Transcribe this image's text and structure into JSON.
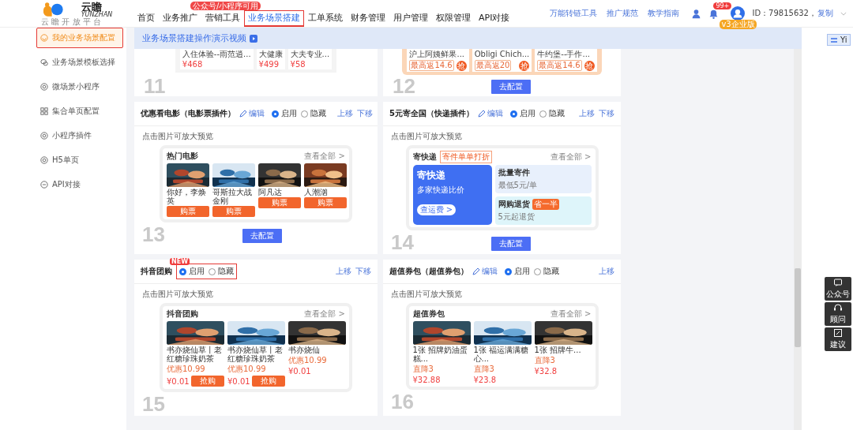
{
  "nav": {
    "logo": {
      "name": "云瞻",
      "latin": "YUNZHAN",
      "tagline": "云 瞻 开 放 平 台"
    },
    "menu": [
      {
        "label": "首页",
        "selected": false,
        "outlined": false
      },
      {
        "label": "业务推广",
        "selected": false,
        "outlined": false
      },
      {
        "label": "营销工具",
        "selected": false,
        "outlined": false,
        "badge": "公众号/小程序可用"
      },
      {
        "label": "业务场景搭建",
        "selected": true,
        "outlined": true
      },
      {
        "label": "工单系统",
        "selected": false,
        "outlined": false
      },
      {
        "label": "财务管理",
        "selected": false,
        "outlined": false
      },
      {
        "label": "用户管理",
        "selected": false,
        "outlined": false
      },
      {
        "label": "权限管理",
        "selected": false,
        "outlined": false
      },
      {
        "label": "API对接",
        "selected": false,
        "outlined": false
      }
    ],
    "links": [
      "万能转链工具",
      "推广规范",
      "教学指南"
    ],
    "notifications": "99+",
    "user": {
      "id": "ID：79815632，",
      "copy": "复制",
      "plan": "v3企业版"
    }
  },
  "sidebar": [
    {
      "label": "我的业务场景配置",
      "selected": true,
      "outlined": true
    },
    {
      "label": "业务场景模板选择",
      "selected": false,
      "outlined": false
    },
    {
      "label": "微场景小程序",
      "selected": false,
      "outlined": false
    },
    {
      "label": "集合单页配置",
      "selected": false,
      "outlined": false
    },
    {
      "label": "小程序插件",
      "selected": false,
      "outlined": false
    },
    {
      "label": "H5单页",
      "selected": false,
      "outlined": false
    },
    {
      "label": "API对接",
      "selected": false,
      "outlined": false
    }
  ],
  "banner": "业务场景搭建操作演示视频",
  "scrolled_cards": [
    {
      "number": "11",
      "preview": {
        "kind": "products",
        "items": [
          {
            "caption": "入住体验--雨范逍...",
            "price": "¥468"
          },
          {
            "caption": "大健康",
            "price": "¥499"
          },
          {
            "caption": "大夫专业...",
            "price": "¥58"
          }
        ]
      }
    },
    {
      "number": "12",
      "configure": "去配置",
      "preview": {
        "kind": "shops",
        "items": [
          {
            "caption": "沪上阿姨鲜果...",
            "tag": "最高返14.6",
            "action": "抢"
          },
          {
            "caption": "Obligi Chich...",
            "tag": "最高返20",
            "action": "抢"
          },
          {
            "caption": "牛约堡--手作...",
            "tag": "最高返14.6",
            "action": "抢"
          }
        ]
      }
    }
  ],
  "cards": [
    {
      "number": "13",
      "title": "优惠看电影（电影票插件）",
      "edit": "编辑",
      "outlined": false,
      "options": [
        {
          "label": "启用",
          "selected": true
        },
        {
          "label": "隐藏",
          "selected": false
        }
      ],
      "moves": [
        "上移",
        "下移"
      ],
      "hint": "点击图片可放大预览",
      "configure": "去配置",
      "preview": {
        "kind": "tiles",
        "title": "热门电影",
        "more": "查看全部 >",
        "items": [
          {
            "caption": "你好，李焕英",
            "action": "购票"
          },
          {
            "caption": "哥斯拉大战金刚",
            "action": "购票"
          },
          {
            "caption": "阿凡达",
            "action": "购票"
          },
          {
            "caption": "人潮汹",
            "action": "购票"
          }
        ]
      }
    },
    {
      "number": "14",
      "title": "5元寄全国（快递插件）",
      "edit": "编辑",
      "outlined": false,
      "options": [
        {
          "label": "启用",
          "selected": true
        },
        {
          "label": "隐藏",
          "selected": false
        }
      ],
      "moves": [
        "上移",
        "下移"
      ],
      "hint": "点击图片可放大预览",
      "configure": "去配置",
      "preview": {
        "kind": "express",
        "title": "寄快递",
        "tag": "寄件单单打折",
        "more": "查看全部 >",
        "main": {
          "title": "寄快递",
          "sub": "多家快递比价",
          "action": "查运费 >"
        },
        "tiles": [
          {
            "title": "批量寄件",
            "sub": "最低5元/单"
          },
          {
            "title": "网购退货",
            "sub": "5元起退货",
            "tag": "省一半"
          }
        ]
      }
    },
    {
      "number": "15",
      "title": "抖音团购",
      "new": "NEW",
      "outlined": true,
      "options": [
        {
          "label": "启用",
          "selected": true
        },
        {
          "label": "隐藏",
          "selected": false
        }
      ],
      "moves": [
        "上移",
        "下移"
      ],
      "hint": "点击图片可放大预览",
      "preview": {
        "kind": "tiles",
        "title": "抖音团购",
        "more": "查看全部 >",
        "items": [
          {
            "caption": "书亦烧仙草丨老红糖珍珠奶茶",
            "price": "¥0.01",
            "note": "优惠10.99",
            "action": "抢购"
          },
          {
            "caption": "书亦烧仙草丨老红糖珍珠奶茶",
            "price": "¥0.01",
            "note": "优惠10.99",
            "action": "抢购"
          },
          {
            "caption": "书亦烧仙",
            "price": "¥0.01",
            "note": "优惠10.99"
          }
        ]
      }
    },
    {
      "number": "16",
      "title": "超值券包（超值券包）",
      "edit": "编辑",
      "outlined": false,
      "options": [
        {
          "label": "启用",
          "selected": true
        },
        {
          "label": "隐藏",
          "selected": false
        }
      ],
      "moves": [
        "上移"
      ],
      "hint": "点击图片可放大预览",
      "preview": {
        "kind": "tiles",
        "title": "超值券包",
        "more": "查看全部 >",
        "items": [
          {
            "caption": "1张 招牌奶油蛋糕...",
            "note": "直降3",
            "price": "¥32.88"
          },
          {
            "caption": "1张 福运满满糖心...",
            "note": "直降3",
            "price": "¥23.8"
          },
          {
            "caption": "1张 招牌牛...",
            "note": "直降3",
            "price": "¥32.8"
          }
        ]
      }
    }
  ],
  "float_tools": [
    "公众号",
    "顾问",
    "建议"
  ],
  "translate_toggle": "Yi"
}
